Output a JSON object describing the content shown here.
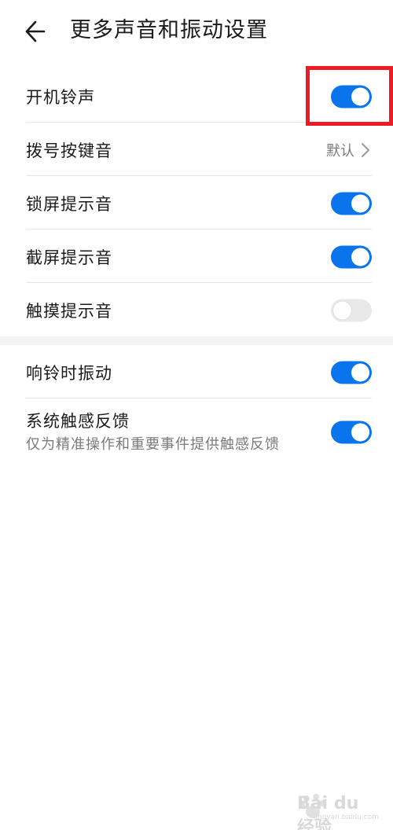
{
  "header": {
    "title": "更多声音和振动设置"
  },
  "settings": [
    {
      "label": "开机铃声",
      "control": "toggle",
      "on": true
    },
    {
      "label": "拨号按键音",
      "control": "value",
      "value": "默认"
    },
    {
      "label": "锁屏提示音",
      "control": "toggle",
      "on": true
    },
    {
      "label": "截屏提示音",
      "control": "toggle",
      "on": true
    },
    {
      "label": "触摸提示音",
      "control": "toggle",
      "on": false
    },
    {
      "label": "响铃时振动",
      "control": "toggle",
      "on": true
    },
    {
      "label": "系统触感反馈",
      "sublabel": "仅为精准操作和重要事件提供触感反馈",
      "control": "toggle",
      "on": true
    }
  ],
  "colors": {
    "accent": "#0a74ec",
    "toggle_off": "#e8e8e8",
    "highlight": "#ee1b24",
    "divider": "#e6e6e6",
    "section_gap": "#f1f3f5"
  },
  "icons": {
    "back": "arrow-left-icon",
    "chevron": "chevron-right-icon"
  },
  "watermark": {
    "text": "Bai du 经验",
    "sub": "jingyan.baidu.com"
  }
}
